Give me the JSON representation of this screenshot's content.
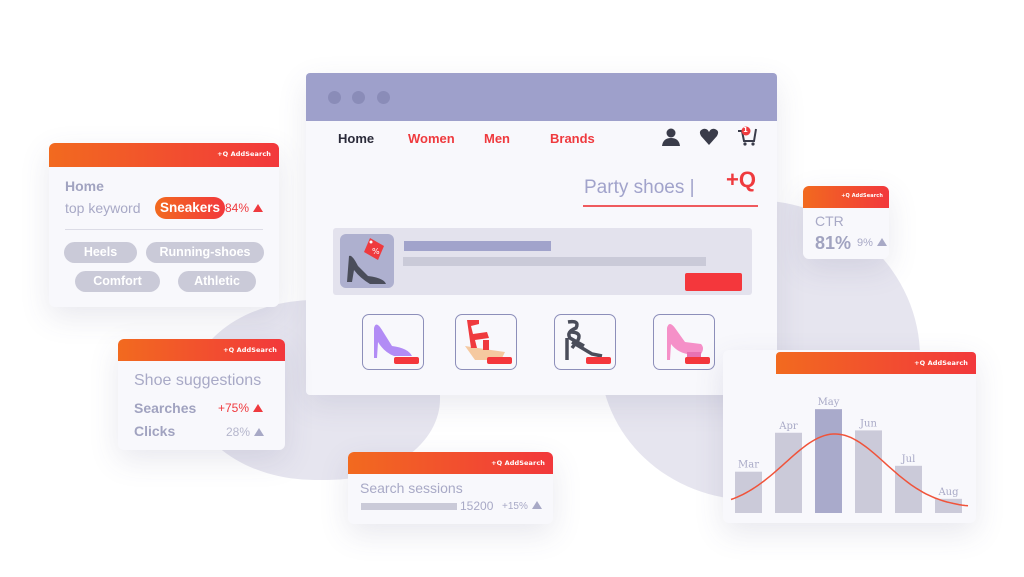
{
  "brand_label": "+Q AddSearch",
  "browser": {
    "nav": [
      {
        "label": "Home",
        "active": true
      },
      {
        "label": "Women",
        "active": false
      },
      {
        "label": "Men",
        "active": false
      },
      {
        "label": "Brands",
        "active": false
      }
    ],
    "cart_count": "1",
    "search": {
      "value": "Party shoes |",
      "logo": "+Q"
    },
    "products": [
      {
        "name": "purple-pump",
        "color": "#b28cf5"
      },
      {
        "name": "red-wedge-sandal",
        "color": "#ef3a3e"
      },
      {
        "name": "black-strappy-heel",
        "color": "#4a4d5a"
      },
      {
        "name": "pink-platform-heel",
        "color": "#f590c8"
      }
    ]
  },
  "keyword_card": {
    "title": "Home",
    "label": "top keyword",
    "keyword": "Sneakers",
    "change": "84%",
    "tags": [
      "Heels",
      "Running-shoes",
      "Comfort",
      "Athletic"
    ]
  },
  "suggestions_card": {
    "title": "Shoe suggestions",
    "rows": [
      {
        "label": "Searches",
        "value": "+75%"
      },
      {
        "label": "Clicks",
        "value": "28%"
      }
    ]
  },
  "sessions_card": {
    "title": "Search sessions",
    "value": "15200",
    "change": "+15%"
  },
  "ctr_card": {
    "title": "CTR",
    "value": "81%",
    "change": "9%"
  },
  "colors": {
    "accent_red": "#ef3a3e",
    "accent_orange": "#f26a1f",
    "lavender": "#9ea0cb",
    "muted": "#cacad8"
  },
  "chart_data": {
    "type": "bar",
    "title": "",
    "categories": [
      "Mar",
      "Apr",
      "May",
      "Jun",
      "Jul",
      "Aug"
    ],
    "values": [
      35,
      68,
      88,
      70,
      40,
      12
    ],
    "highlight": "May",
    "trend_curve": "normal-distribution overlay peaking between May and Jun",
    "xlabel": "",
    "ylabel": "",
    "ylim": [
      0,
      100
    ],
    "grid": false
  }
}
